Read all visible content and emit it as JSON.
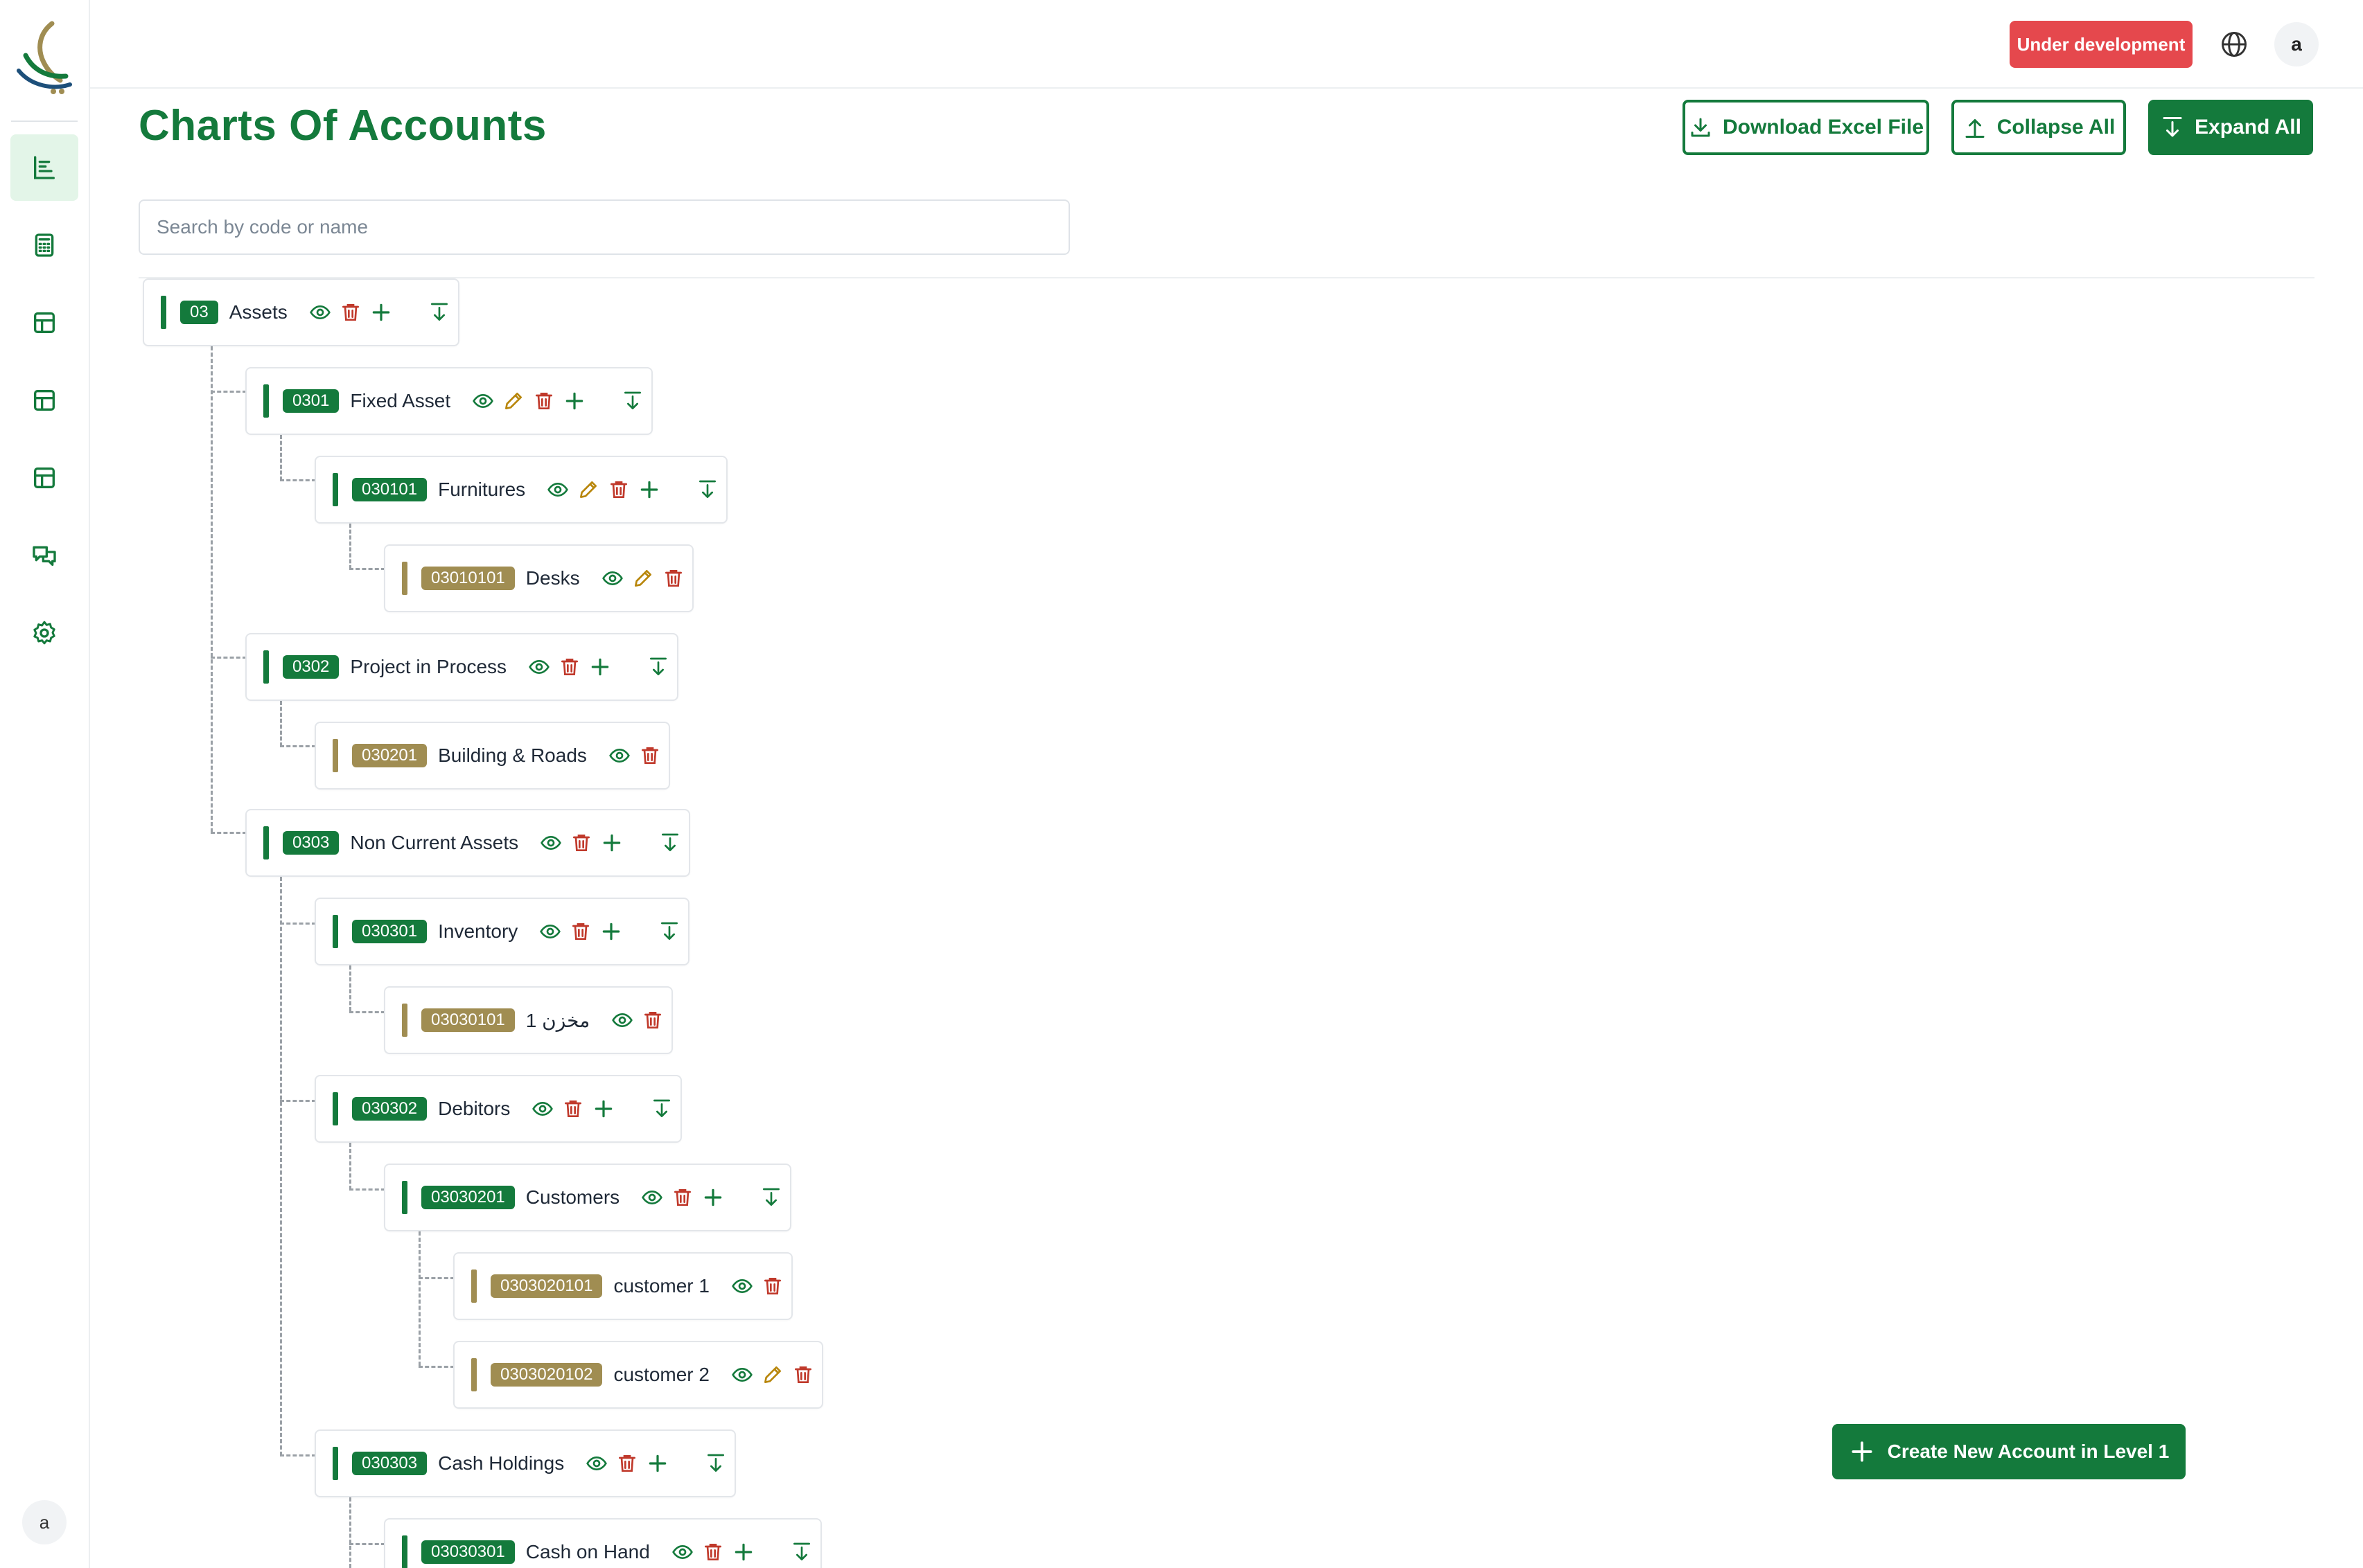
{
  "header": {
    "title": "Charts Of Accounts",
    "download_label": "Download Excel File",
    "collapse_label": "Collapse All",
    "expand_label": "Expand All"
  },
  "topbar": {
    "status_badge": "Under development",
    "avatar_initial": "a"
  },
  "sidebar": {
    "avatar_initial": "a",
    "items": [
      {
        "icon": "chart-list-icon",
        "active": true
      },
      {
        "icon": "calculator-icon",
        "active": false
      },
      {
        "icon": "table-icon",
        "active": false
      },
      {
        "icon": "table-icon",
        "active": false
      },
      {
        "icon": "table-icon",
        "active": false
      },
      {
        "icon": "chat-icon",
        "active": false
      },
      {
        "icon": "gear-icon",
        "active": false
      }
    ]
  },
  "search": {
    "placeholder": "Search by code or name",
    "value": ""
  },
  "tree": [
    {
      "code": "03",
      "name": "Assets"
    },
    {
      "code": "0301",
      "name": "Fixed Asset"
    },
    {
      "code": "030101",
      "name": "Furnitures"
    },
    {
      "code": "03010101",
      "name": "Desks"
    },
    {
      "code": "0302",
      "name": "Project in Process"
    },
    {
      "code": "030201",
      "name": "Building & Roads"
    },
    {
      "code": "0303",
      "name": "Non Current Assets"
    },
    {
      "code": "030301",
      "name": "Inventory"
    },
    {
      "code": "03030101",
      "name": "مخزن 1"
    },
    {
      "code": "030302",
      "name": "Debitors"
    },
    {
      "code": "03030201",
      "name": "Customers"
    },
    {
      "code": "0303020101",
      "name": "customer 1"
    },
    {
      "code": "0303020102",
      "name": "customer 2"
    },
    {
      "code": "030303",
      "name": "Cash Holdings"
    },
    {
      "code": "03030301",
      "name": "Cash on Hand"
    }
  ],
  "create_button_label": "Create New Account in Level 1",
  "colors": {
    "primary": "#147a3c",
    "leaf": "#a08d52",
    "danger": "#c0392b",
    "edit": "#b8860b",
    "badge": "#e5484d"
  }
}
